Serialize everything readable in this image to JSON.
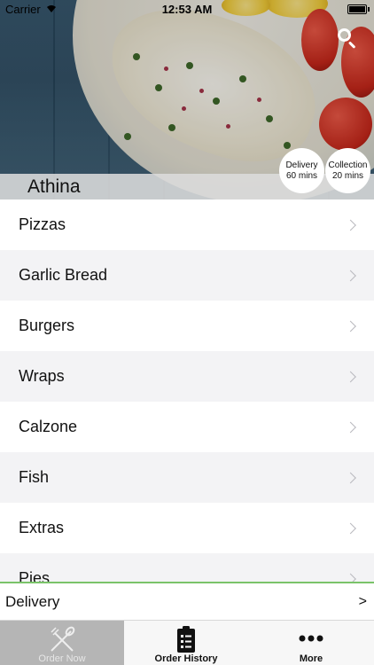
{
  "status_bar": {
    "carrier": "Carrier",
    "time": "12:53 AM"
  },
  "restaurant": {
    "name": "Athina"
  },
  "badges": {
    "delivery": {
      "title": "Delivery",
      "time": "60 mins"
    },
    "collection": {
      "title": "Collection",
      "time": "20 mins"
    }
  },
  "menu": {
    "items": [
      {
        "label": "Pizzas"
      },
      {
        "label": "Garlic Bread"
      },
      {
        "label": "Burgers"
      },
      {
        "label": "Wraps"
      },
      {
        "label": "Calzone"
      },
      {
        "label": "Fish"
      },
      {
        "label": "Extras"
      },
      {
        "label": "Pies"
      }
    ]
  },
  "delivery_bar": {
    "label": "Delivery",
    "arrow": ">"
  },
  "tabs": [
    {
      "label": "Order Now",
      "icon": "fork-spoon-icon",
      "active": true
    },
    {
      "label": "Order History",
      "icon": "clipboard-list-icon",
      "active": false
    },
    {
      "label": "More",
      "icon": "more-dots-icon",
      "active": false
    }
  ],
  "colors": {
    "accent_line": "#7ac36a",
    "active_tab": "#b5b5b5"
  }
}
